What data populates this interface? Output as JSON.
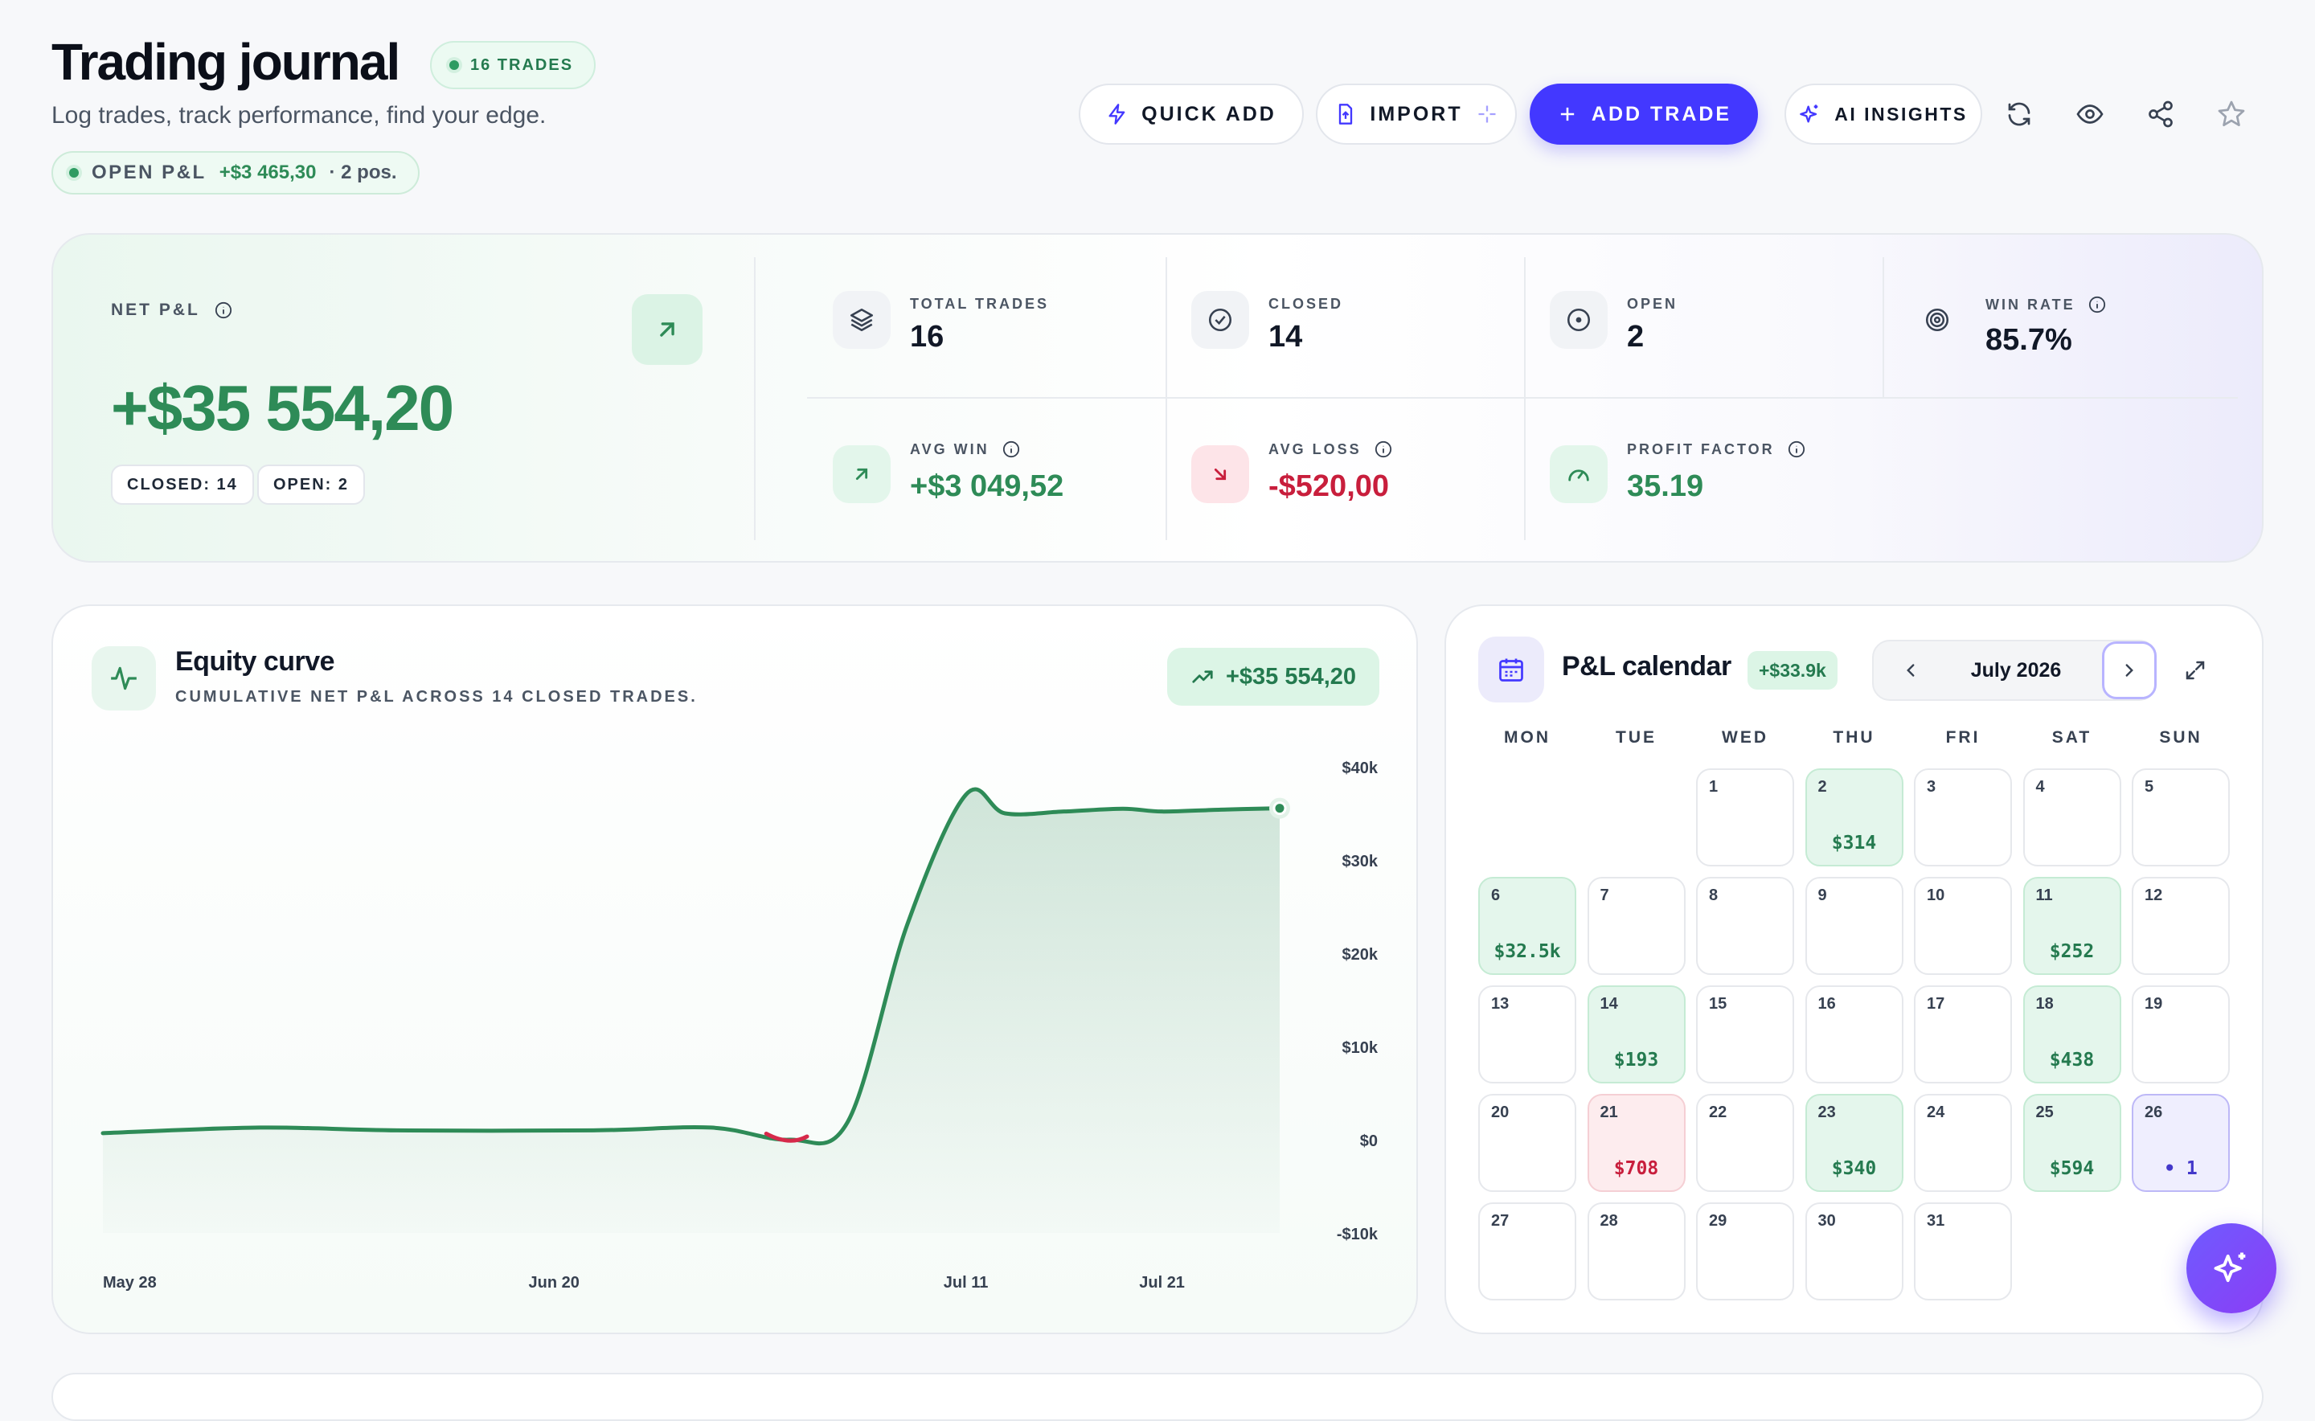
{
  "header": {
    "title": "Trading journal",
    "trades_badge": "16 TRADES",
    "subtitle": "Log trades, track performance, find your edge.",
    "open_pl": {
      "label": "OPEN P&L",
      "value": "+$3 465,30",
      "positions": "· 2 pos."
    }
  },
  "toolbar": {
    "quick_add": "QUICK ADD",
    "import": "IMPORT",
    "add_trade": "ADD TRADE",
    "ai_insights": "AI INSIGHTS",
    "icons": [
      "refresh-icon",
      "eye-icon",
      "share-icon",
      "star-icon"
    ]
  },
  "stats": {
    "net_pl": {
      "label": "NET P&L",
      "value": "+$35 554,20",
      "closed": "CLOSED: 14",
      "open": "OPEN: 2"
    },
    "total_trades": {
      "label": "TOTAL TRADES",
      "value": "16"
    },
    "closed": {
      "label": "CLOSED",
      "value": "14"
    },
    "open": {
      "label": "OPEN",
      "value": "2"
    },
    "win_rate": {
      "label": "WIN RATE",
      "value": "85.7%"
    },
    "avg_win": {
      "label": "AVG WIN",
      "value": "+$3 049,52"
    },
    "avg_loss": {
      "label": "AVG LOSS",
      "value": "-$520,00"
    },
    "profit_factor": {
      "label": "PROFIT FACTOR",
      "value": "35.19"
    },
    "colors": {
      "positive": "#2e8b57",
      "negative": "#c81e3c"
    }
  },
  "equity": {
    "title": "Equity curve",
    "subtitle": "CUMULATIVE NET P&L ACROSS 14 CLOSED TRADES.",
    "badge": "+$35 554,20"
  },
  "chart_data": {
    "type": "area",
    "title": "Equity curve",
    "x_tick_labels": [
      "May 28",
      "Jun 20",
      "Jul 11",
      "Jul 21"
    ],
    "y_tick_labels": [
      "$40k",
      "$30k",
      "$20k",
      "$10k",
      "$0",
      "-$10k"
    ],
    "ylim": [
      -10000,
      40000
    ],
    "grid": false,
    "series": [
      {
        "points": [
          {
            "x": "2026-05-28",
            "y": 700
          },
          {
            "x": "2026-06-05",
            "y": 1300
          },
          {
            "x": "2026-06-12",
            "y": 1000
          },
          {
            "x": "2026-06-22",
            "y": 1000
          },
          {
            "x": "2026-06-28",
            "y": 1300
          },
          {
            "x": "2026-07-02",
            "y": 0
          },
          {
            "x": "2026-07-05",
            "y": 2000
          },
          {
            "x": "2026-07-08",
            "y": 23000
          },
          {
            "x": "2026-07-11",
            "y": 37000
          },
          {
            "x": "2026-07-13",
            "y": 35000
          },
          {
            "x": "2026-07-16",
            "y": 35200
          },
          {
            "x": "2026-07-19",
            "y": 35500
          },
          {
            "x": "2026-07-21",
            "y": 35200
          },
          {
            "x": "2026-07-24",
            "y": 35400
          },
          {
            "x": "2026-07-27",
            "y": 35554.2
          }
        ]
      }
    ],
    "colors": {
      "line": "#2e8b57",
      "negative_segment": "#d6294a"
    }
  },
  "calendar": {
    "title": "P&L calendar",
    "badge": "+$33.9k",
    "month": "July 2026",
    "weekdays": [
      "MON",
      "TUE",
      "WED",
      "THU",
      "FRI",
      "SAT",
      "SUN"
    ],
    "days": [
      {
        "d": "1",
        "amt": "",
        "type": ""
      },
      {
        "d": "2",
        "amt": "$314",
        "type": "win"
      },
      {
        "d": "3",
        "amt": "",
        "type": ""
      },
      {
        "d": "4",
        "amt": "",
        "type": ""
      },
      {
        "d": "5",
        "amt": "",
        "type": ""
      },
      {
        "d": "6",
        "amt": "$32.5k",
        "type": "win"
      },
      {
        "d": "7",
        "amt": "",
        "type": ""
      },
      {
        "d": "8",
        "amt": "",
        "type": ""
      },
      {
        "d": "9",
        "amt": "",
        "type": ""
      },
      {
        "d": "10",
        "amt": "",
        "type": ""
      },
      {
        "d": "11",
        "amt": "$252",
        "type": "win"
      },
      {
        "d": "12",
        "amt": "",
        "type": ""
      },
      {
        "d": "13",
        "amt": "",
        "type": ""
      },
      {
        "d": "14",
        "amt": "$193",
        "type": "win"
      },
      {
        "d": "15",
        "amt": "",
        "type": ""
      },
      {
        "d": "16",
        "amt": "",
        "type": ""
      },
      {
        "d": "17",
        "amt": "",
        "type": ""
      },
      {
        "d": "18",
        "amt": "$438",
        "type": "win"
      },
      {
        "d": "19",
        "amt": "",
        "type": ""
      },
      {
        "d": "20",
        "amt": "",
        "type": ""
      },
      {
        "d": "21",
        "amt": "$708",
        "type": "loss"
      },
      {
        "d": "22",
        "amt": "",
        "type": ""
      },
      {
        "d": "23",
        "amt": "$340",
        "type": "win"
      },
      {
        "d": "24",
        "amt": "",
        "type": ""
      },
      {
        "d": "25",
        "amt": "$594",
        "type": "win"
      },
      {
        "d": "26",
        "amt": "• 1",
        "type": "today"
      },
      {
        "d": "27",
        "amt": "",
        "type": ""
      },
      {
        "d": "28",
        "amt": "",
        "type": ""
      },
      {
        "d": "29",
        "amt": "",
        "type": ""
      },
      {
        "d": "30",
        "amt": "",
        "type": ""
      },
      {
        "d": "31",
        "amt": "",
        "type": ""
      }
    ]
  }
}
